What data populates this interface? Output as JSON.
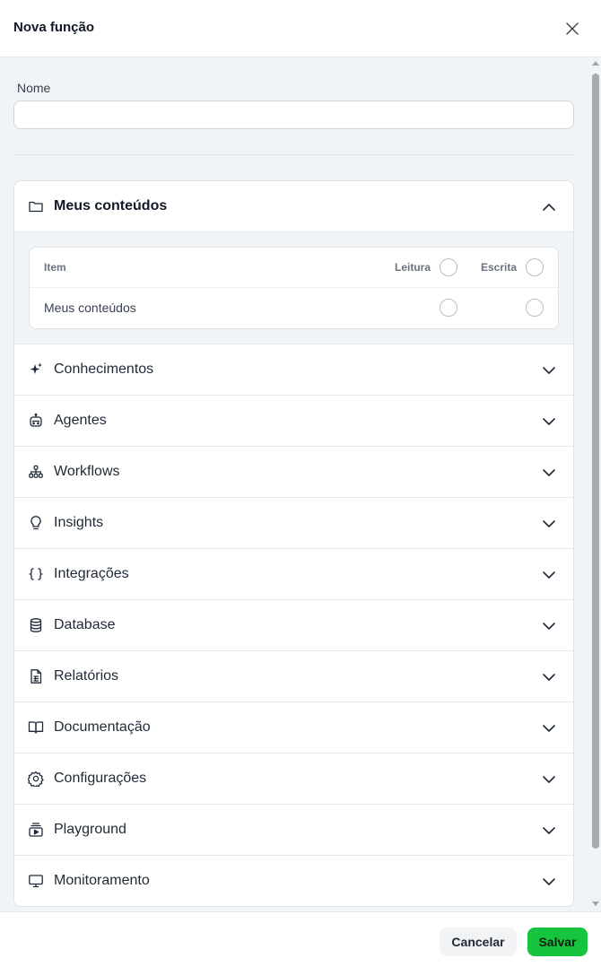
{
  "header": {
    "title": "Nova função",
    "close_icon": "close-icon"
  },
  "form": {
    "name_label": "Nome",
    "name_value": "",
    "name_placeholder": ""
  },
  "sections": [
    {
      "label": "Meus conteúdos",
      "icon": "folder-icon",
      "expanded": true
    },
    {
      "label": "Conhecimentos",
      "icon": "sparkles-icon",
      "expanded": false
    },
    {
      "label": "Agentes",
      "icon": "bot-icon",
      "expanded": false
    },
    {
      "label": "Workflows",
      "icon": "workflow-icon",
      "expanded": false
    },
    {
      "label": "Insights",
      "icon": "lightbulb-icon",
      "expanded": false
    },
    {
      "label": "Integrações",
      "icon": "braces-icon",
      "expanded": false
    },
    {
      "label": "Database",
      "icon": "database-icon",
      "expanded": false
    },
    {
      "label": "Relatórios",
      "icon": "report-icon",
      "expanded": false
    },
    {
      "label": "Documentação",
      "icon": "book-icon",
      "expanded": false
    },
    {
      "label": "Configurações",
      "icon": "gear-icon",
      "expanded": false
    },
    {
      "label": "Playground",
      "icon": "playground-icon",
      "expanded": false
    },
    {
      "label": "Monitoramento",
      "icon": "monitor-icon",
      "expanded": false
    }
  ],
  "permissions": {
    "columns": {
      "item": "Item",
      "read": "Leitura",
      "write": "Escrita"
    },
    "rows": [
      {
        "label": "Meus conteúdos",
        "read": false,
        "write": false
      }
    ]
  },
  "footer": {
    "cancel_label": "Cancelar",
    "save_label": "Salvar"
  },
  "colors": {
    "primary": "#16c43f",
    "body_bg": "#f1f4f7",
    "border": "#e5e7eb"
  }
}
